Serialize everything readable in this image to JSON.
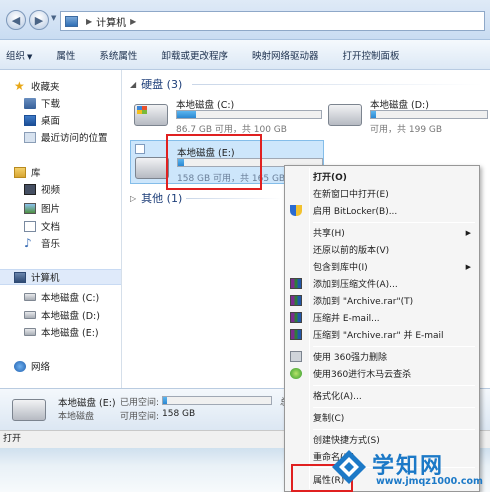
{
  "address": {
    "path": "计算机"
  },
  "toolbar": {
    "organize": "组织",
    "properties": "属性",
    "system_properties": "系统属性",
    "uninstall": "卸载或更改程序",
    "map_drive": "映射网络驱动器",
    "control_panel": "打开控制面板"
  },
  "sidebar": {
    "favorites": "收藏夹",
    "downloads": "下载",
    "desktop": "桌面",
    "recent": "最近访问的位置",
    "library": "库",
    "video": "视频",
    "pictures": "图片",
    "documents": "文档",
    "music": "音乐",
    "computer": "计算机",
    "drive_c": "本地磁盘 (C:)",
    "drive_d": "本地磁盘 (D:)",
    "drive_e": "本地磁盘 (E:)",
    "network": "网络"
  },
  "main": {
    "group_hdd": "硬盘 (3)",
    "group_other": "其他 (1)",
    "drives": [
      {
        "name": "本地磁盘 (C:)",
        "info": "86.7 GB 可用，共 100 GB",
        "used_fraction": 0.13
      },
      {
        "name": "本地磁盘 (D:)",
        "info": "可用，共 199 GB",
        "used_fraction": 0.04
      },
      {
        "name": "本地磁盘 (E:)",
        "info": "158 GB 可用，共 165 GB",
        "used_fraction": 0.04
      }
    ]
  },
  "details": {
    "name": "本地磁盘 (E:)",
    "type": "本地磁盘",
    "used_label": "已用空间:",
    "free_label": "可用空间:",
    "free_value": "158 GB",
    "used_fraction": 0.04,
    "trunc": "总"
  },
  "status": {
    "text": "打开"
  },
  "menu": {
    "open": "打开(O)",
    "open_new_window": "在新窗口中打开(E)",
    "bitlocker": "启用 BitLocker(B)...",
    "share": "共享(H)",
    "restore": "还原以前的版本(V)",
    "include_library": "包含到库中(I)",
    "add_archive": "添加到压缩文件(A)...",
    "add_rar": "添加到 \"Archive.rar\"(T)",
    "compress_email": "压缩并 E-mail...",
    "compress_rar_email": "压缩到 \"Archive.rar\" 并 E-mail",
    "del360": "使用 360强力删除",
    "scan360": "使用360进行木马云查杀",
    "format": "格式化(A)...",
    "copy": "复制(C)",
    "shortcut": "创建快捷方式(S)",
    "rename": "重命名(M)",
    "properties": "属性(R)"
  },
  "watermark": {
    "title": "学知网",
    "url": "www.jmqz1000.com"
  }
}
